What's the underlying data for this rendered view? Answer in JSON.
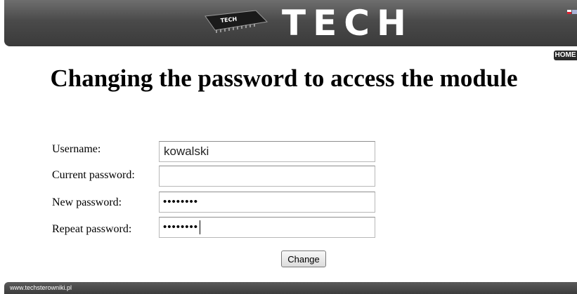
{
  "header": {
    "logo_chip_text": "TECH",
    "logo_text": "TECH",
    "languages": [
      "pl-flag-icon",
      "en-flag-icon"
    ]
  },
  "nav": {
    "home_label": "HOME"
  },
  "page": {
    "title": "Changing the password to access the module"
  },
  "form": {
    "username_label": "Username:",
    "username_value": "kowalski",
    "current_password_label": "Current password:",
    "current_password_value": "",
    "new_password_label": "New password:",
    "new_password_value": "••••••••",
    "repeat_password_label": "Repeat password:",
    "repeat_password_value": "••••••••",
    "submit_label": "Change"
  },
  "footer": {
    "text": "www.techsterowniki.pl"
  },
  "colors": {
    "header_bg": "#4a4a4a",
    "home_bg": "#2b2b2b",
    "text": "#000000"
  }
}
